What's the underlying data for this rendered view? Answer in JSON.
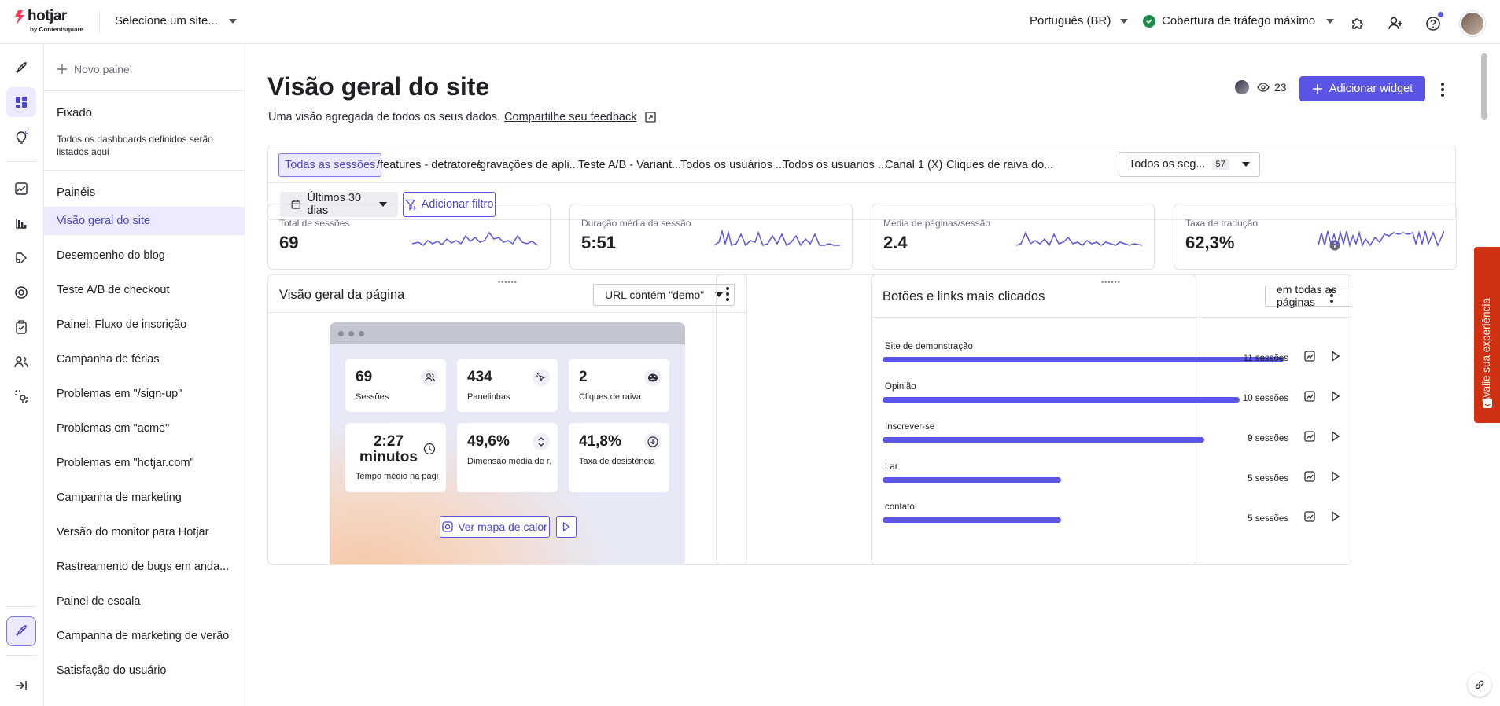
{
  "header": {
    "logo_text": "hotjar",
    "logo_sub": "by Contentsquare",
    "site_select": "Selecione um site...",
    "language": "Português (BR)",
    "coverage": "Cobertura de tráfego máximo",
    "icons": [
      "puzzle-icon",
      "add-user-icon",
      "help-icon",
      "avatar"
    ]
  },
  "rail": {
    "icons": [
      "rocket-icon",
      "dashboard-icon",
      "lightbulb-icon",
      "trends-icon",
      "funnels-icon",
      "recordings-icon",
      "heatmaps-icon",
      "surveys-icon",
      "users-icon",
      "engage-icon",
      "rocket-icon",
      "collapse-icon"
    ]
  },
  "sidebar": {
    "new_panel": "Novo painel",
    "pinned_heading": "Fixado",
    "pinned_note": "Todos os dashboards definidos serão listados aqui",
    "panels_heading": "Painéis",
    "items": [
      "Visão geral do site",
      "Desempenho do blog",
      "Teste A/B de checkout",
      "Painel: Fluxo de inscrição",
      "Campanha de férias",
      "Problemas em \"/sign-up\"",
      "Problemas em \"acme\"",
      "Problemas em \"hotjar.com\"",
      "Campanha de marketing",
      "Versão do monitor para Hotjar",
      "Rastreamento de bugs em anda...",
      "Painel de escala",
      "Campanha de marketing de verão",
      "Satisfação do usuário"
    ]
  },
  "page": {
    "title": "Visão geral do site",
    "subtitle": "Uma visão agregada de todos os seus dados.",
    "feedback_link": "Compartilhe seu feedback",
    "viewer_count": "23",
    "add_widget": "Adicionar widget"
  },
  "segments": {
    "tabs": [
      "Todas as sessões",
      "/features - detratores",
      "/gravações de apli...",
      "Teste A/B - Variant...",
      "Todos os usuários ...",
      "Todos os usuários ...",
      "Canal 1 (X)",
      "Cliques de raiva do..."
    ],
    "dropdown_label": "Todos os seg...",
    "dropdown_count": "57",
    "date_range": "Últimos 30 dias",
    "add_filter": "Adicionar filtro"
  },
  "kpis": [
    {
      "label": "Total de sessões",
      "value": "69"
    },
    {
      "label": "Duração média da sessão",
      "value": "5:51"
    },
    {
      "label": "Média de páginas/sessão",
      "value": "2.4"
    },
    {
      "label": "Taxa de tradução",
      "value": "62,3%"
    }
  ],
  "page_overview": {
    "title": "Visão geral da página",
    "filter": "URL contém \"demo\"",
    "cards": [
      {
        "value": "69",
        "label": "Sessões",
        "icon": "users-icon"
      },
      {
        "value": "434",
        "label": "Panelinhas",
        "icon": "click-icon"
      },
      {
        "value": "2",
        "label": "Cliques de raiva",
        "icon": "rage-face-icon"
      },
      {
        "value": "2:27 minutos",
        "label": "Tempo médio na pági...",
        "icon": "clock-icon"
      },
      {
        "value": "49,6%",
        "label": "Dimensão média de r...",
        "icon": "scroll-icon"
      },
      {
        "value": "41,8%",
        "label": "Taxa de desistência",
        "icon": "exit-icon"
      }
    ],
    "heatmap_button": "Ver mapa de calor"
  },
  "top_clicks": {
    "title": "Botões e links mais clicados",
    "filter": "em todas as páginas",
    "rows": [
      {
        "label": "Site de demonstração",
        "sessions": "11 sessões",
        "value": 11
      },
      {
        "label": "Opinião",
        "sessions": "10 sessões",
        "value": 10
      },
      {
        "label": "Inscrever-se",
        "sessions": "9 sessões",
        "value": 9
      },
      {
        "label": "Lar",
        "sessions": "5 sessões",
        "value": 5
      },
      {
        "label": "contato",
        "sessions": "5 sessões",
        "value": 5
      }
    ]
  },
  "feedback_tab": "Avalie sua experiência",
  "colors": {
    "accent": "#5a55e6",
    "feedback": "#cf3212",
    "success": "#1f8b4c"
  }
}
